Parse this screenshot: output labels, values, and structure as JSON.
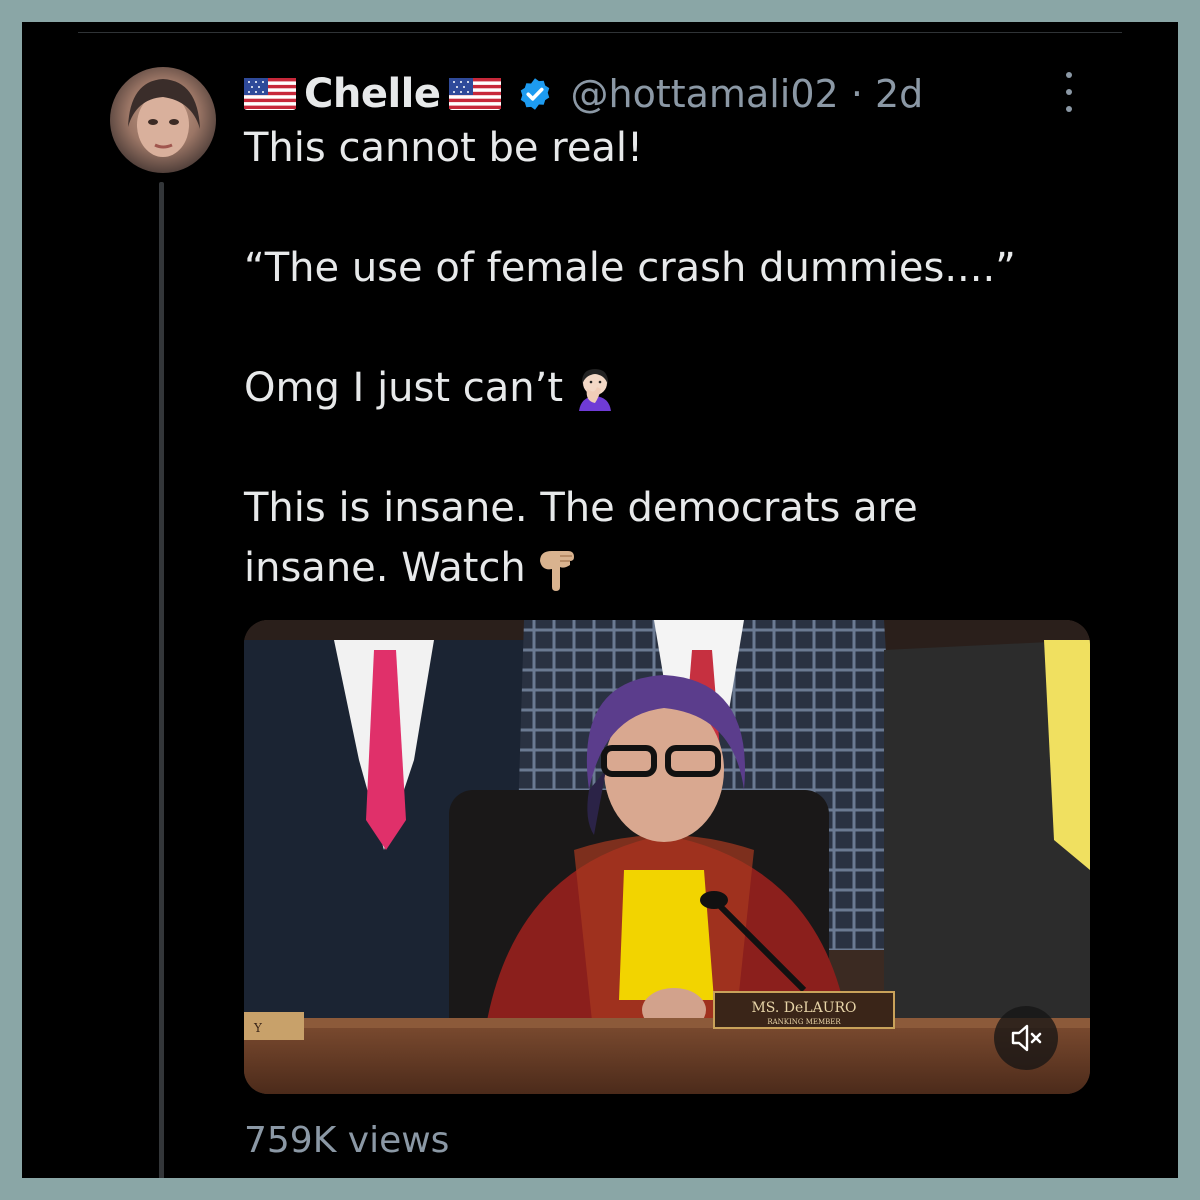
{
  "tweet": {
    "display_name": "Chelle",
    "handle": "@hottamali02",
    "separator": "·",
    "time": "2d",
    "lines": {
      "l1": "This cannot be real!",
      "l2": "“The use of female crash dummies....”",
      "l3": "Omg I just can’t",
      "l4a": "This is insane. The democrats are",
      "l4b": "insane. Watch"
    },
    "views": "759K views"
  },
  "video": {
    "nameplate": "MS. DeLAURO",
    "nameplate_sub": "RANKING MEMBER",
    "nameplate_left": "Y"
  },
  "icons": {
    "flag": "us-flag-icon",
    "verified": "verified-badge-icon",
    "more": "more-options-icon",
    "face_palm": "woman-facepalming-emoji",
    "pointing_down": "backhand-index-pointing-down-emoji",
    "mute": "speaker-muted-icon"
  },
  "colors": {
    "background": "#000000",
    "frame": "#8aa6a6",
    "text": "#e7e9ea",
    "secondary": "#8b98a5",
    "verified": "#1d9bf0"
  }
}
